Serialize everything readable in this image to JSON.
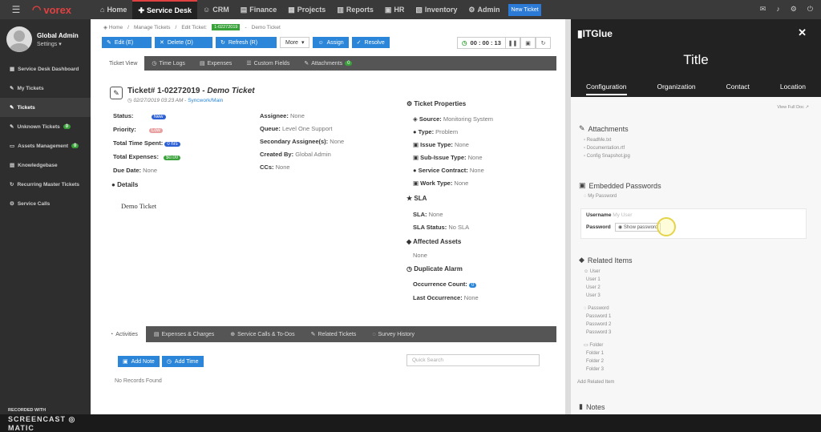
{
  "topbar": {
    "brand": "vorex",
    "nav": [
      {
        "label": "Home",
        "icon": "home-icon"
      },
      {
        "label": "Service Desk",
        "icon": "wrench-icon",
        "active": true
      },
      {
        "label": "CRM",
        "icon": "users-icon"
      },
      {
        "label": "Finance",
        "icon": "money-icon"
      },
      {
        "label": "Projects",
        "icon": "projects-icon"
      },
      {
        "label": "Reports",
        "icon": "reports-icon"
      },
      {
        "label": "HR",
        "icon": "hr-icon"
      },
      {
        "label": "Inventory",
        "icon": "inventory-icon"
      },
      {
        "label": "Admin",
        "icon": "gear-icon"
      }
    ],
    "new_ticket": "New Ticket"
  },
  "sidebar": {
    "user_name": "Global Admin",
    "settings": "Settings",
    "items": [
      {
        "label": "Service Desk Dashboard"
      },
      {
        "label": "My Tickets"
      },
      {
        "label": "Tickets",
        "active": true
      },
      {
        "label": "Unknown Tickets",
        "badge": "0"
      },
      {
        "label": "Assets Management",
        "badge": "0"
      },
      {
        "label": "Knowledgebase"
      },
      {
        "label": "Recurring Master Tickets"
      },
      {
        "label": "Service Calls"
      }
    ],
    "recorded_with": "RECORDED WITH",
    "screencast": "SCREENCAST",
    "matic": "MATIC"
  },
  "breadcrumb": {
    "home": "Home",
    "manage": "Manage Tickets",
    "edit": "Edit Ticket:",
    "badge": "1-02272019",
    "current": "Demo Ticket"
  },
  "toolbar": {
    "edit": "Edit (E)",
    "delete": "Delete (D)",
    "refresh": "Refresh (R)",
    "more": "More",
    "assign": "Assign",
    "resolve": "Resolve",
    "timer": "00 : 00 : 13"
  },
  "tabs": [
    "Ticket View",
    "Time Logs",
    "Expenses",
    "Custom Fields",
    "Attachments"
  ],
  "attachments_count": "0",
  "ticket": {
    "number": "Ticket# 1-02272019",
    "title": "Demo Ticket",
    "date": "02/27/2019 03:23 AM",
    "org": "Syncwork/Main",
    "status_label": "Status:",
    "status": "New",
    "priority_label": "Priority:",
    "priority": "Low",
    "time_label": "Total Time Spent:",
    "time": "0 hrs",
    "expenses_label": "Total Expenses:",
    "expenses": "$0.00",
    "due_label": "Due Date:",
    "due": "None",
    "assignee_label": "Assignee:",
    "assignee": "None",
    "queue_label": "Queue:",
    "queue": "Level One Support",
    "secondary_label": "Secondary Assignee(s):",
    "secondary": "None",
    "created_label": "Created By:",
    "created": "Global Admin",
    "ccs_label": "CCs:",
    "ccs": "None",
    "details_title": "Details",
    "description": "Demo Ticket"
  },
  "properties": {
    "title": "Ticket Properties",
    "source_label": "Source:",
    "source": "Monitoring System",
    "type_label": "Type:",
    "type": "Problem",
    "issue_label": "Issue Type:",
    "issue": "None",
    "subissue_label": "Sub-Issue Type:",
    "subissue": "None",
    "contract_label": "Service Contract:",
    "contract": "None",
    "work_label": "Work Type:",
    "work": "None",
    "sla_title": "SLA",
    "sla_label": "SLA:",
    "sla": "None",
    "sla_status_label": "SLA Status:",
    "sla_status": "No SLA",
    "assets_title": "Affected Assets",
    "assets": "None",
    "dup_title": "Duplicate Alarm",
    "occ_label": "Occurrence Count:",
    "occ": "0",
    "last_label": "Last Occurrence:",
    "last": "None"
  },
  "bottom_tabs": [
    "Activities",
    "Expenses & Charges",
    "Service Calls & To-Dos",
    "Related Tickets",
    "Survey History"
  ],
  "activities": {
    "add_note": "Add Note",
    "add_time": "Add Time",
    "quick_search": "Quick Search",
    "no_records": "No Records Found"
  },
  "itglue": {
    "brand": "ITGlue",
    "title": "Title",
    "tabs": [
      "Configuration",
      "Organization",
      "Contact",
      "Location"
    ],
    "view_full": "View Full Doc",
    "attachments_title": "Attachments",
    "attachments": [
      "ReadMe.txt",
      "Documentation.rtf",
      "Config Snapshot.jpg"
    ],
    "embedded_title": "Embedded Passwords",
    "my_password": "My Password",
    "username_label": "Username",
    "username": "My User",
    "password_label": "Password",
    "show_password": "Show password",
    "related_title": "Related Items",
    "user_group": "User",
    "users": [
      "User 1",
      "User 2",
      "User 3"
    ],
    "password_group": "Password",
    "passwords": [
      "Password 1",
      "Password 2",
      "Password 3"
    ],
    "folder_group": "Folder",
    "folders": [
      "Folder 1",
      "Folder 2",
      "Folder 3"
    ],
    "add_related": "Add Related Item",
    "notes": "Notes"
  }
}
